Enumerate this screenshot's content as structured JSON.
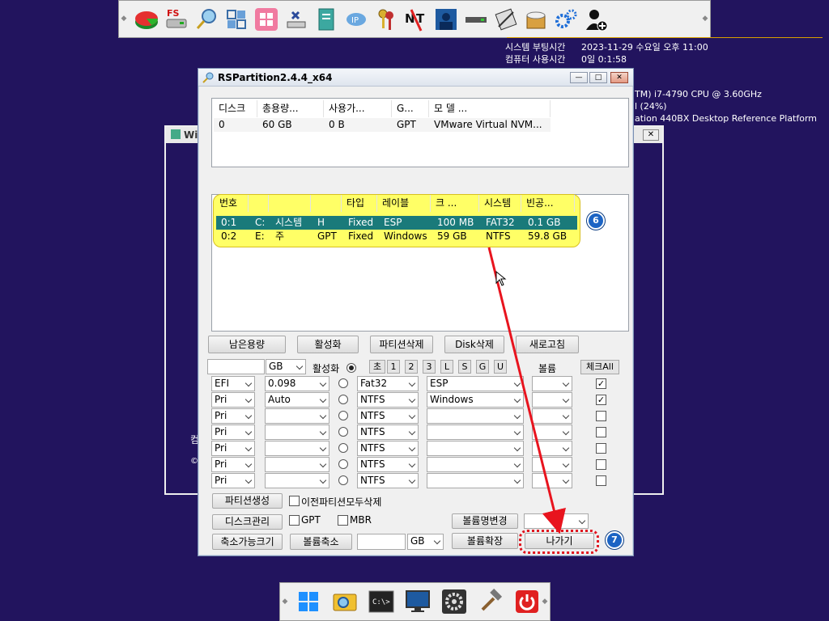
{
  "top_launcher": {
    "icons": [
      "partition-pie-icon",
      "fs-drive-icon",
      "search-wizard-icon",
      "windows-tiles-icon",
      "windows-logo-icon",
      "network-drive-icon",
      "document-icon",
      "wifi-icon",
      "keys-icon",
      "no-network-icon",
      "user-portrait-icon",
      "drive-bar-icon",
      "floppy-tools-icon",
      "disk-box-icon",
      "gears-icon",
      "add-user-icon"
    ],
    "fs_label": "FS"
  },
  "system_info": {
    "boot_time_label": "시스템 부팅시간",
    "boot_time_value": "2023-11-29 수요일 오후 11:00",
    "uptime_label": "컴퓨터 사용시간",
    "uptime_value": "0일 0:1:58",
    "cpu_partial": "TM) i7-4790 CPU @ 3.60GHz",
    "usage_partial": "l (24%)",
    "board_partial": "ation 440BX Desktop Reference Platform"
  },
  "bg_window": {
    "title_partial": "Wi",
    "close_label": "✕",
    "side_text_1": "컴",
    "side_text_2": "©"
  },
  "main_window": {
    "title": "RSPartition2.4.4_x64",
    "min_label": "—",
    "max_label": "□",
    "close_label": "✕",
    "disk_table": {
      "headers": [
        "디스크",
        "총용량...",
        "사용가...",
        "G...",
        "모    델    ..."
      ],
      "rows": [
        [
          "0",
          "60 GB",
          "0 B",
          "GPT",
          "VMware Virtual NVM..."
        ]
      ]
    },
    "partition_table": {
      "headers": [
        "번호",
        "",
        "",
        "",
        "타입",
        "레이블",
        "크 ...",
        "시스템",
        "빈공..."
      ],
      "rows": [
        [
          "0:1",
          "C:",
          "시스템",
          "H",
          "Fixed",
          "ESP",
          "100 MB",
          "FAT32",
          "0.1 GB"
        ],
        [
          "0:2",
          "E:",
          "주",
          "GPT",
          "Fixed",
          "Windows",
          "59 GB",
          "NTFS",
          "59.8 GB"
        ]
      ]
    },
    "action_buttons": [
      "남은용량",
      "활성화",
      "파티션삭제",
      "Disk삭제",
      "새로고침"
    ],
    "size_unit": "GB",
    "active_label": "활성화",
    "unit_buttons": [
      "초",
      "1",
      "2",
      "3",
      "L",
      "S",
      "G",
      "U"
    ],
    "volume_label": "볼륨",
    "check_all_label": "체크All",
    "partition_rows": [
      {
        "type": "EFI",
        "size": "0.098",
        "fs": "Fat32",
        "label": "ESP",
        "vol": "",
        "checked": true
      },
      {
        "type": "Pri",
        "size": "Auto",
        "fs": "NTFS",
        "label": "Windows",
        "vol": "",
        "checked": true
      },
      {
        "type": "Pri",
        "size": "",
        "fs": "NTFS",
        "label": "",
        "vol": "",
        "checked": false
      },
      {
        "type": "Pri",
        "size": "",
        "fs": "NTFS",
        "label": "",
        "vol": "",
        "checked": false
      },
      {
        "type": "Pri",
        "size": "",
        "fs": "NTFS",
        "label": "",
        "vol": "",
        "checked": false
      },
      {
        "type": "Pri",
        "size": "",
        "fs": "NTFS",
        "label": "",
        "vol": "",
        "checked": false
      },
      {
        "type": "Pri",
        "size": "",
        "fs": "NTFS",
        "label": "",
        "vol": "",
        "checked": false
      }
    ],
    "create_partition_label": "파티션생성",
    "delete_all_label": "이전파티션모두삭제",
    "disk_manage_label": "디스크관리",
    "gpt_label": "GPT",
    "mbr_label": "MBR",
    "rename_volume_label": "볼륨명변경",
    "shrinkable_label": "축소가능크기",
    "shrink_label": "볼륨축소",
    "shrink_unit": "GB",
    "extend_label": "볼륨확장",
    "exit_label": "나가기"
  },
  "annotations": {
    "step6": "6",
    "step7": "7",
    "highlight_color": "#ffff66",
    "arrow_color": "#e8141e"
  },
  "bottom_taskbar": {
    "icons": [
      "windows-start-icon",
      "folder-search-icon",
      "command-prompt-icon",
      "monitor-icon",
      "settings-gear-icon",
      "hammer-tools-icon",
      "power-icon"
    ],
    "cmd_label": "C:\\>"
  }
}
